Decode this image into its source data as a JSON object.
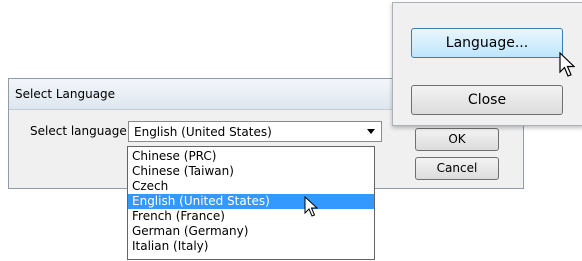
{
  "dialog": {
    "title": "Select Language",
    "label": "Select language:",
    "selected_value": "English (United States)",
    "ok_label": "OK",
    "cancel_label": "Cancel"
  },
  "dropdown": {
    "items": [
      "Chinese (PRC)",
      "Chinese (Taiwan)",
      "Czech",
      "English (United States)",
      "French (France)",
      "German (Germany)",
      "Italian (Italy)"
    ],
    "highlighted_item": "English (United States)"
  },
  "popup": {
    "language_button": "Language...",
    "close_button": "Close"
  },
  "colors": {
    "selection": "#3399ff",
    "hover_button": "#bee6fd"
  }
}
